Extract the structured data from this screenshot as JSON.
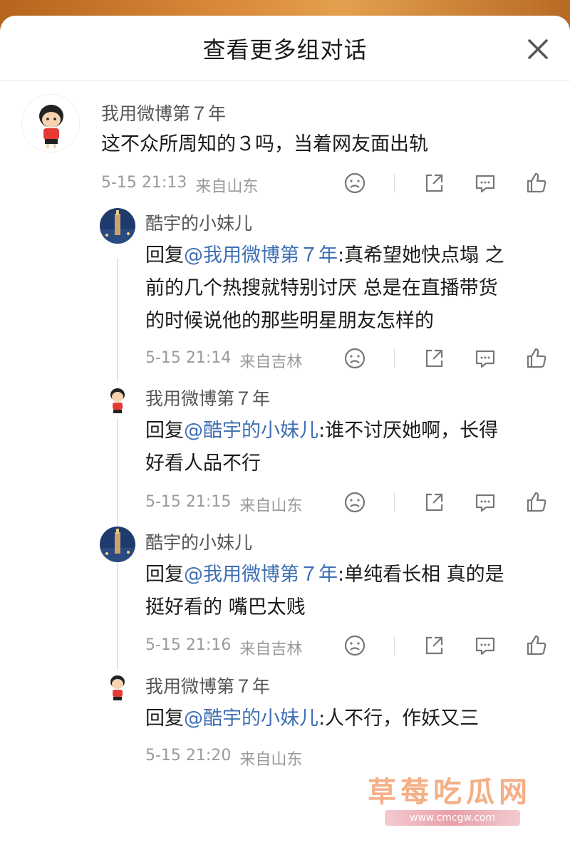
{
  "header": {
    "title": "查看更多组对话"
  },
  "main_comment": {
    "user": "我用微博第７年",
    "text": "这不众所周知的３吗，当着网友面出轨",
    "time": "5-15 21:13",
    "source": "来自山东"
  },
  "replies": [
    {
      "user": "酷宇的小妹儿",
      "reply_prefix": "回复",
      "mention": "@我用微博第７年",
      "text_lines": [
        ":真希望她快点塌 之",
        "前的几个热搜就特别讨厌 总是在直播带货",
        "的时候说他的那些明星朋友怎样的"
      ],
      "time": "5-15 21:14",
      "source": "来自吉林"
    },
    {
      "user": "我用微博第７年",
      "reply_prefix": "回复",
      "mention": "@酷宇的小妹儿",
      "text_lines": [
        ":谁不讨厌她啊，长得",
        "好看人品不行"
      ],
      "time": "5-15 21:15",
      "source": "来自山东"
    },
    {
      "user": "酷宇的小妹儿",
      "reply_prefix": "回复",
      "mention": "@我用微博第７年",
      "text_lines": [
        ":单纯看长相 真的是",
        "挺好看的 嘴巴太贱"
      ],
      "time": "5-15 21:16",
      "source": "来自吉林"
    },
    {
      "user": "我用微博第７年",
      "reply_prefix": "回复",
      "mention": "@酷宇的小妹儿",
      "text_lines": [
        ":人不行，作妖又三"
      ],
      "time": "5-15 21:20",
      "source": "来自山东"
    }
  ],
  "watermark": {
    "text": "草莓吃瓜网",
    "url": "www.cmcgw.com"
  },
  "icons": [
    "close-icon",
    "dislike-face-icon",
    "share-icon",
    "comment-icon",
    "like-icon"
  ]
}
